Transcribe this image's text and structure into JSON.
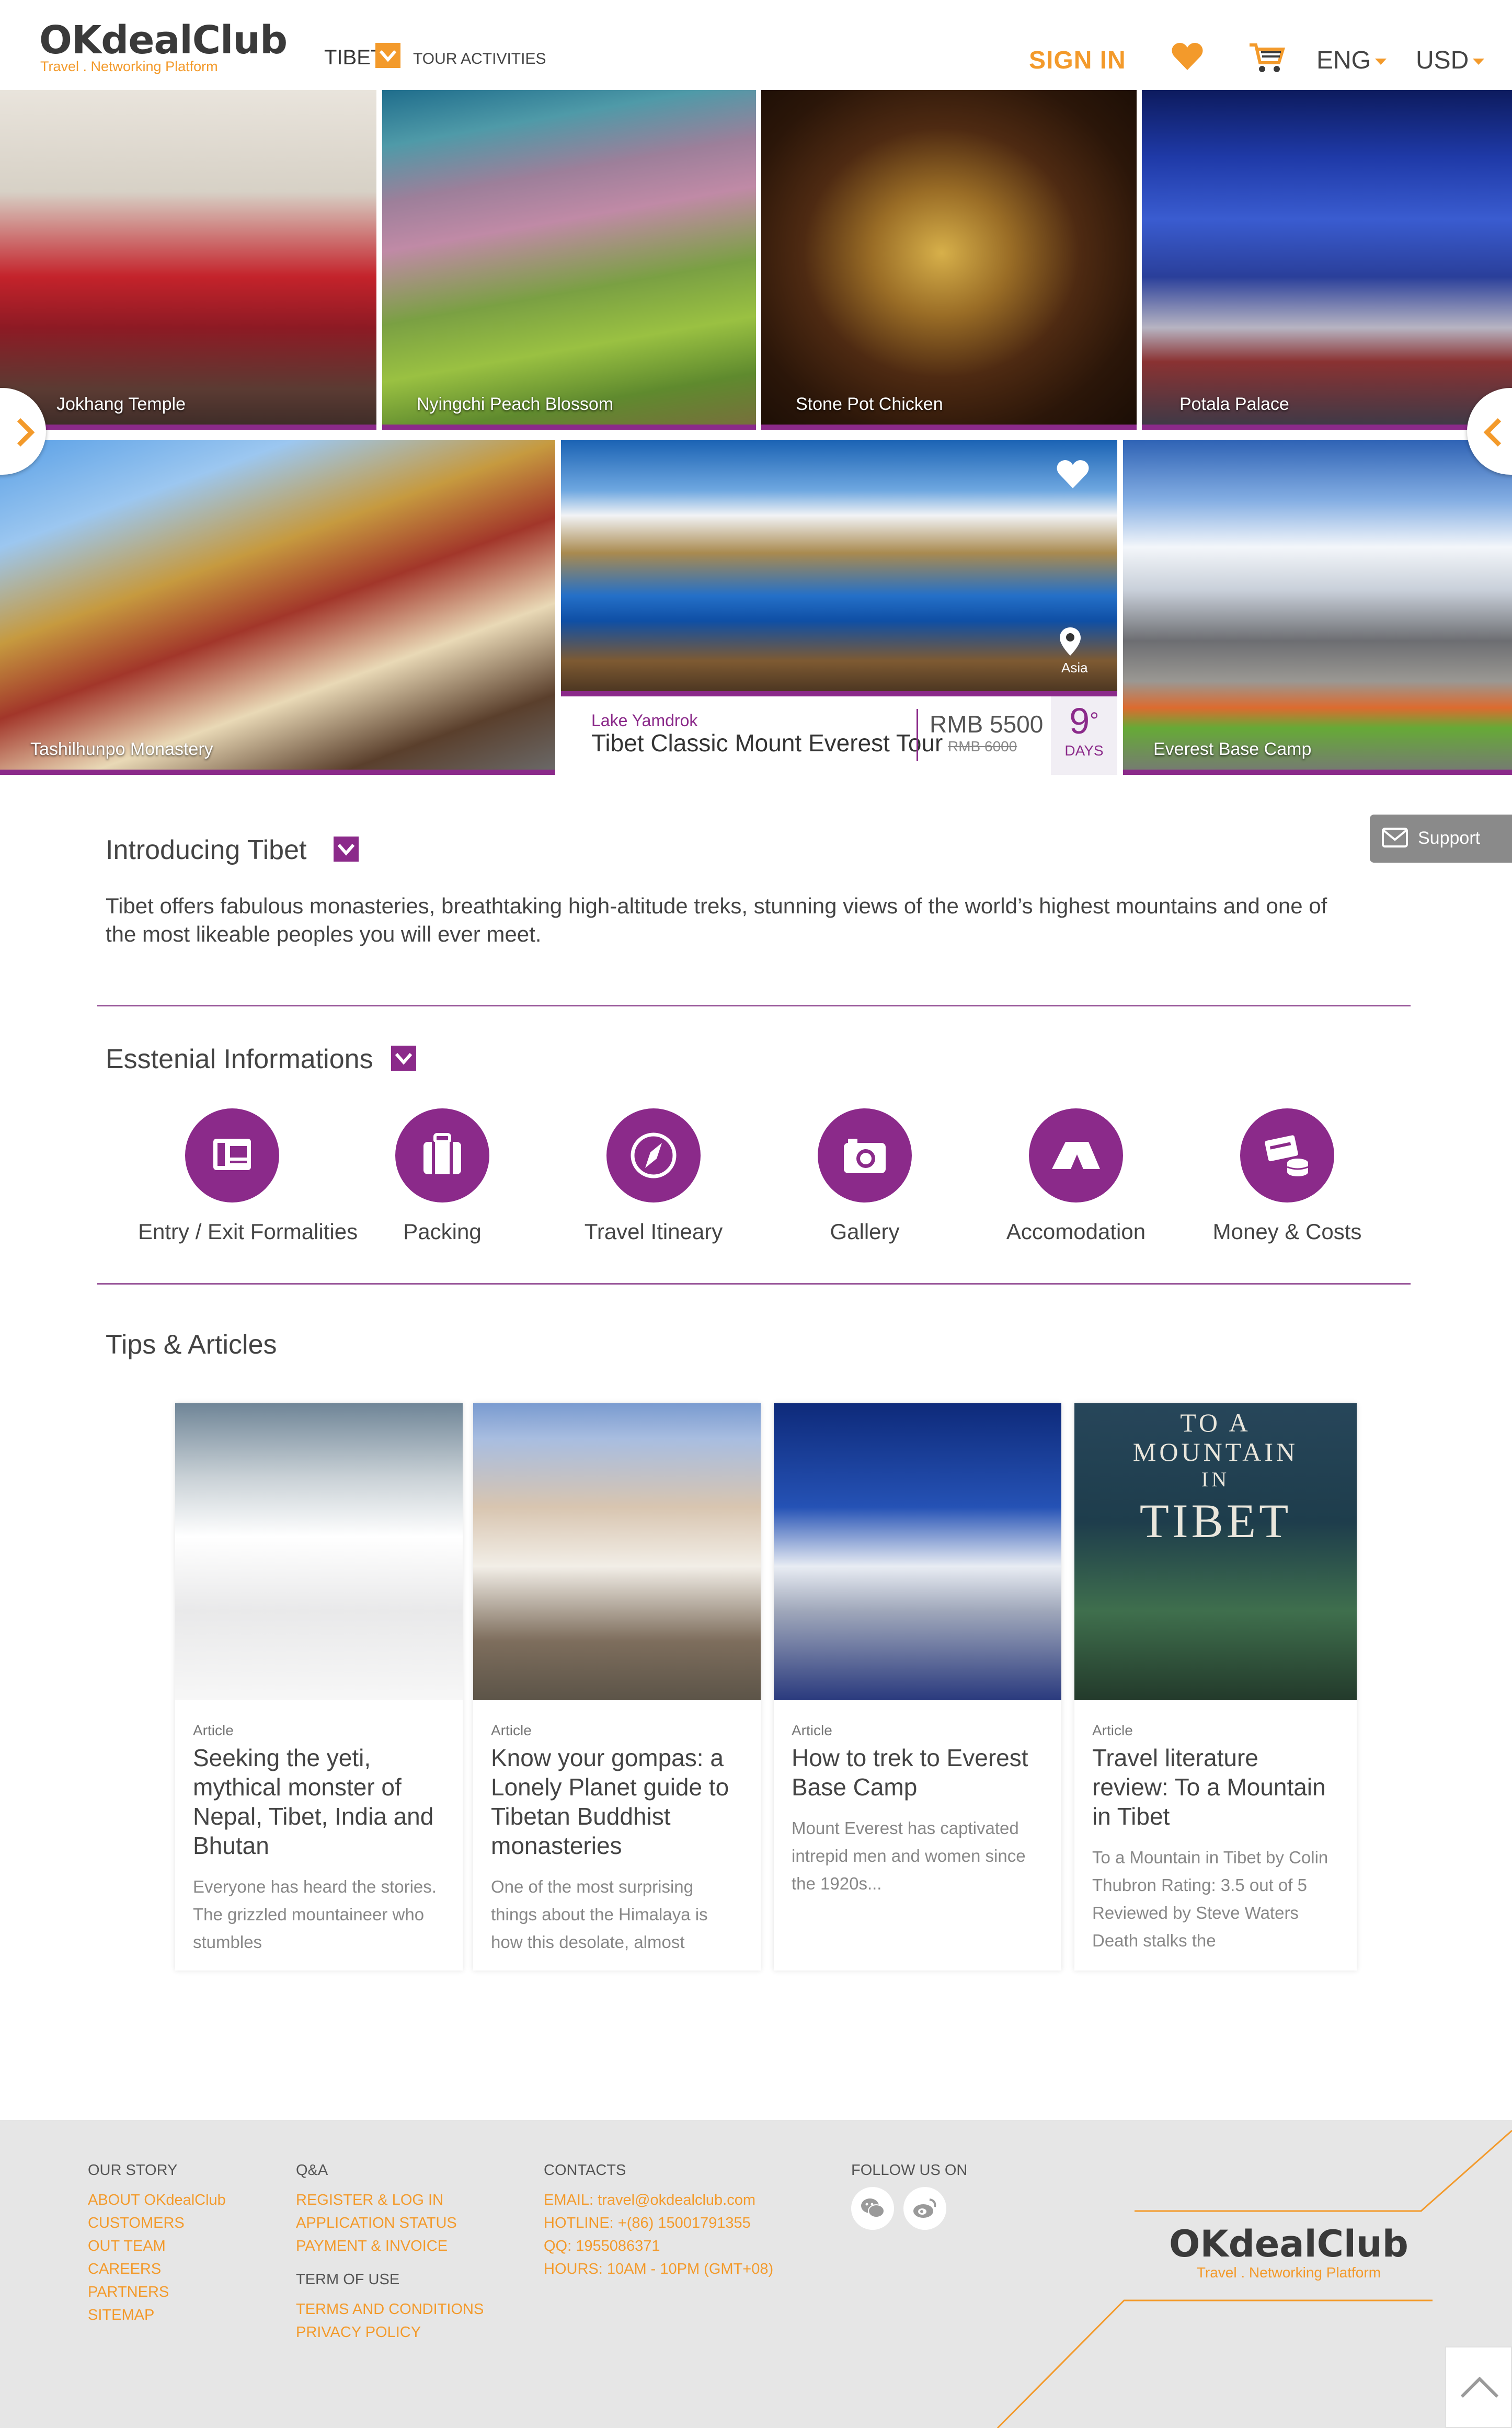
{
  "header": {
    "logo_main": "OKdealClub",
    "logo_sub": "Travel . Networking Platform",
    "destination": "TIBET",
    "tour_activities": "TOUR ACTIVITIES",
    "sign_in": "SIGN IN",
    "language": "ENG",
    "currency": "USD"
  },
  "gallery": {
    "tiles": [
      {
        "label": "Jokhang Temple"
      },
      {
        "label": "Nyingchi Peach Blossom"
      },
      {
        "label": "Stone Pot Chicken"
      },
      {
        "label": "Potala Palace"
      },
      {
        "label": "Tashilhunpo Monastery"
      },
      {
        "label": "Lake Yamdrok"
      },
      {
        "label": "Everest Base Camp"
      }
    ],
    "featured_tour": {
      "location": "Lake Yamdrok",
      "name": "Tibet Classic Mount Everest Tour",
      "region": "Asia",
      "price": "RMB 5500",
      "old_price": "RMB 6000",
      "days_number": "9",
      "days_label": "DAYS"
    }
  },
  "support_label": "Support",
  "intro": {
    "title": "Introducing Tibet",
    "text": "Tibet offers fabulous monasteries, breathtaking high-altitude treks, stunning views of the world’s highest mountains and one of the most likeable peoples you will ever meet."
  },
  "essentials": {
    "title": "Esstenial Informations",
    "items": [
      {
        "label": "Entry / Exit Formalities",
        "icon": "passport-icon"
      },
      {
        "label": "Packing",
        "icon": "suitcase-icon"
      },
      {
        "label": "Travel Itineary",
        "icon": "compass-icon"
      },
      {
        "label": "Gallery",
        "icon": "camera-icon"
      },
      {
        "label": "Accomodation",
        "icon": "tent-icon"
      },
      {
        "label": "Money & Costs",
        "icon": "money-icon"
      }
    ]
  },
  "tips": {
    "title": "Tips & Articles",
    "articles": [
      {
        "kind": "Article",
        "title": "Seeking the yeti, mythical monster of Nepal, Tibet, India and Bhutan",
        "desc": "Everyone has heard the stories. The grizzled mountaineer who stumbles"
      },
      {
        "kind": "Article",
        "title": "Know your gompas: a Lonely Planet guide to Tibetan Buddhist monasteries",
        "desc": "One of the most surprising things about the Himalaya is how this desolate, almost"
      },
      {
        "kind": "Article",
        "title": "How to trek to Everest Base Camp",
        "desc": "Mount Everest has captivated intrepid men and women since the 1920s..."
      },
      {
        "kind": "Article",
        "title": "Travel literature review: To a Mountain in Tibet",
        "desc": "To a Mountain in Tibet by Colin Thubron Rating: 3.5 out of 5 Reviewed by Steve Waters Death stalks the",
        "cover_text": [
          "TO A",
          "MOUNTAIN",
          "IN",
          "TIBET"
        ]
      }
    ]
  },
  "footer": {
    "our_story": {
      "head": "OUR STORY",
      "links": [
        "ABOUT OKdealClub",
        "CUSTOMERS",
        "OUT TEAM",
        "CAREERS",
        "PARTNERS",
        "SITEMAP"
      ]
    },
    "qa": {
      "head": "Q&A",
      "links": [
        "REGISTER & LOG IN",
        "APPLICATION STATUS",
        "PAYMENT & INVOICE"
      ]
    },
    "term": {
      "head": "TERM OF USE",
      "links": [
        "TERMS AND CONDITIONS",
        "PRIVACY POLICY"
      ]
    },
    "contacts": {
      "head": "CONTACTS",
      "links": [
        "EMAIL: travel@okdealclub.com",
        "HOTLINE: +(86) 15001791355",
        "QQ: 1955086371",
        "HOURS: 10AM - 10PM (GMT+08)"
      ]
    },
    "follow": {
      "head": "FOLLOW US ON",
      "icons": [
        "wechat-icon",
        "weibo-icon"
      ]
    },
    "logo_main": "OKdealClub",
    "logo_sub": "Travel . Networking Platform"
  },
  "colors": {
    "accent": "#f39a2b",
    "brand_purple": "#8b2a8a",
    "footer_bg": "#e6e6e6"
  }
}
